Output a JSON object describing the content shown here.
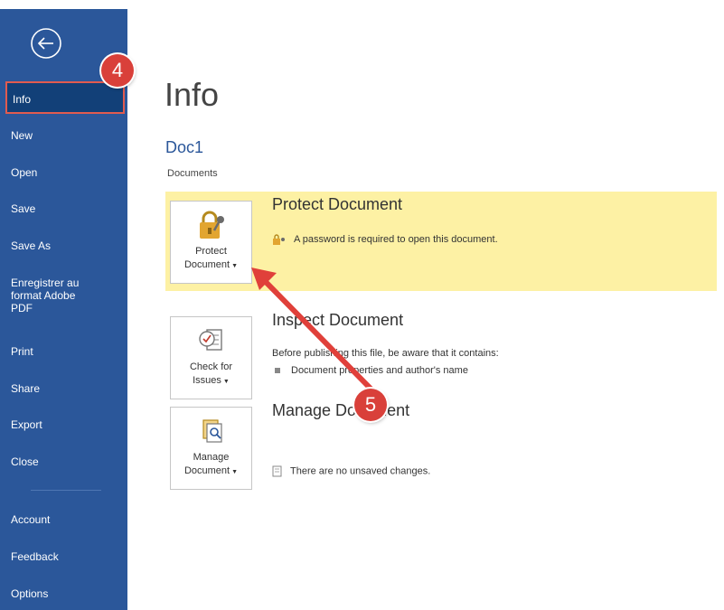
{
  "sidebar": {
    "back_icon": "back-arrow-icon",
    "items": [
      {
        "label": "Info"
      },
      {
        "label": "New"
      },
      {
        "label": "Open"
      },
      {
        "label": "Save"
      },
      {
        "label": "Save As"
      },
      {
        "label": "Enregistrer au format Adobe PDF"
      },
      {
        "label": "Print"
      },
      {
        "label": "Share"
      },
      {
        "label": "Export"
      },
      {
        "label": "Close"
      },
      {
        "label": "Account"
      },
      {
        "label": "Feedback"
      },
      {
        "label": "Options"
      }
    ]
  },
  "main": {
    "title": "Info",
    "doc_name": "Doc1",
    "doc_location": "Documents",
    "protect": {
      "title": "Protect Document",
      "button_line1": "Protect",
      "button_line2": "Document",
      "description": "A password is required to open this document."
    },
    "inspect": {
      "title": "Inspect Document",
      "button_line1": "Check for",
      "button_line2": "Issues",
      "description": "Before publishing this file, be aware that it contains:",
      "bullet": "Document properties and author's name"
    },
    "manage": {
      "title": "Manage Document",
      "button_line1": "Manage",
      "button_line2": "Document",
      "description": "There are no unsaved changes."
    }
  },
  "callouts": {
    "step4": "4",
    "step5": "5"
  },
  "colors": {
    "sidebar": "#2b579a",
    "active_item": "#124078",
    "highlight": "#fdf1a4",
    "callout": "#d9403a",
    "doc_name": "#2b579a"
  }
}
